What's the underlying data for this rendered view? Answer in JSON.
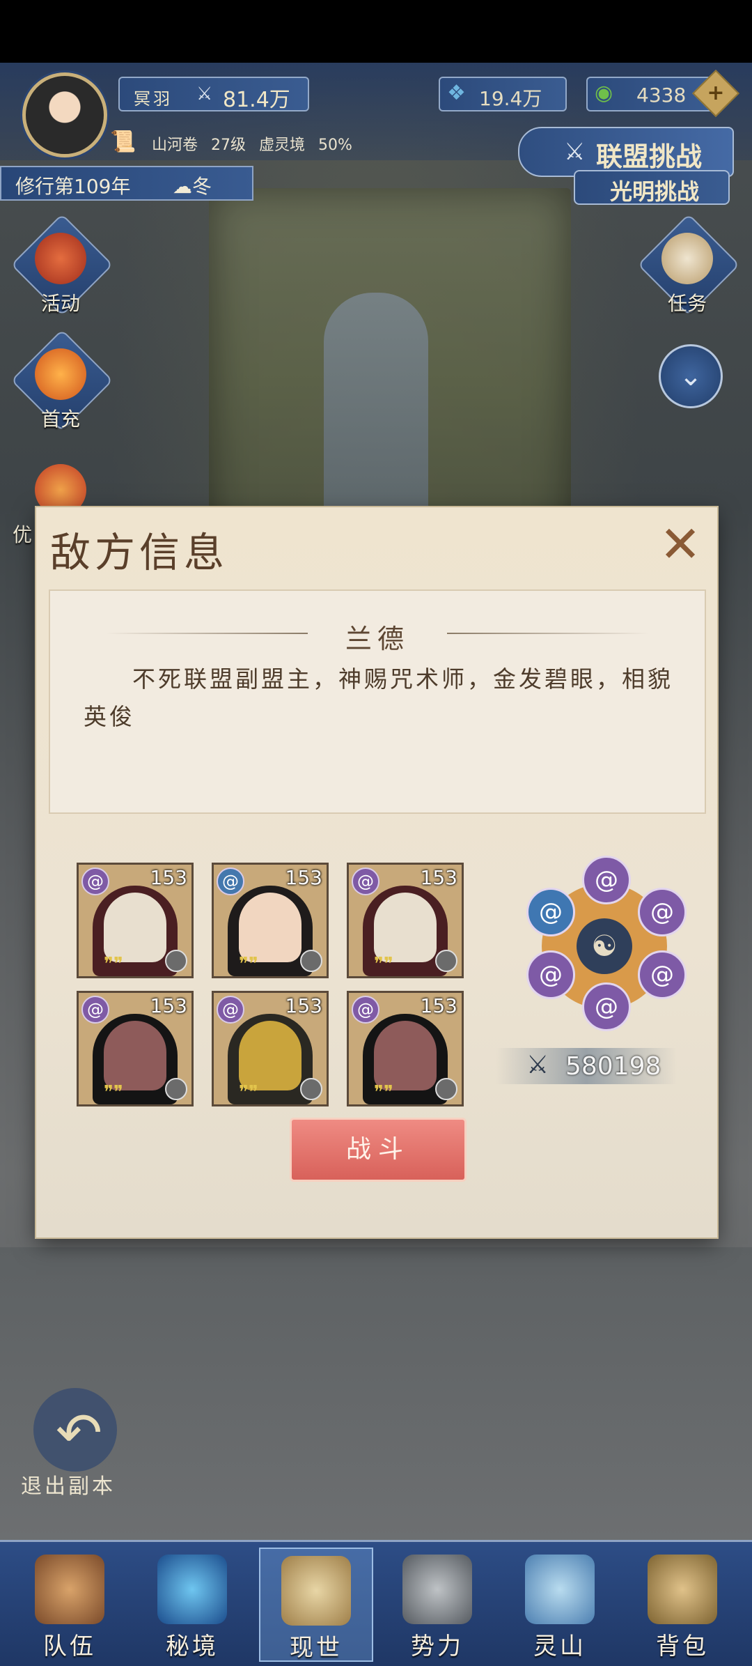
{
  "hud": {
    "player_name": "冥羽",
    "power": "81.4万",
    "crystal": "19.4万",
    "jade": "4338",
    "scroll": {
      "chapter": "山河卷",
      "level": "27级",
      "realm": "虚灵境",
      "progress": "50%"
    },
    "cultivation_year": "修行第109年",
    "season": "冬"
  },
  "top_right": {
    "alliance_challenge": "联盟挑战",
    "light_challenge": "光明挑战"
  },
  "side_left": [
    {
      "label": "活动"
    },
    {
      "label": "首充"
    },
    {
      "label": "优"
    }
  ],
  "side_right": [
    {
      "label": "任务"
    }
  ],
  "dialog": {
    "title": "敌方信息",
    "enemy_name": "兰德",
    "description": "不死联盟副盟主，神赐咒术师，金发碧眼，相貌英俊",
    "heroes": [
      {
        "level": "153",
        "class_icon": "purple-swirl-icon"
      },
      {
        "level": "153",
        "class_icon": "blue-swirl-icon"
      },
      {
        "level": "153",
        "class_icon": "purple-swirl-icon"
      },
      {
        "level": "153",
        "class_icon": "purple-swirl-icon"
      },
      {
        "level": "153",
        "class_icon": "purple-swirl-icon"
      },
      {
        "level": "153",
        "class_icon": "purple-swirl-icon"
      }
    ],
    "total_power": "580198",
    "fight_label": "战斗"
  },
  "exit_label": "退出副本",
  "nav": [
    {
      "label": "队伍"
    },
    {
      "label": "秘境"
    },
    {
      "label": "现世"
    },
    {
      "label": "势力"
    },
    {
      "label": "灵山"
    },
    {
      "label": "背包"
    }
  ],
  "colors": {
    "accent_blue": "#2d4d86",
    "fight_red": "#d8615a",
    "parchment": "#efe4cf"
  }
}
